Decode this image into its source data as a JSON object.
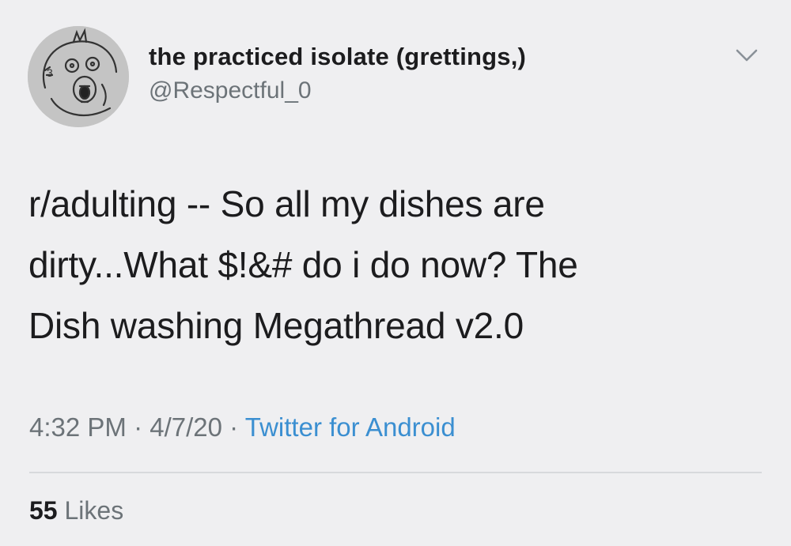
{
  "author": {
    "display_name": "the practiced isolate (grettings,)",
    "handle": "@Respectful_0",
    "avatar_icon": "hand-drawn-face-avatar"
  },
  "tweet": {
    "text": "r/adulting -- So all my dishes are\ndirty...What $!&# do i do now? The\nDish washing Megathread v2.0"
  },
  "meta": {
    "time": "4:32 PM",
    "separator": "·",
    "date": "4/7/20",
    "source": "Twitter for Android"
  },
  "stats": {
    "likes_count": "55",
    "likes_label": "Likes"
  },
  "colors": {
    "background": "#efeff1",
    "text": "#1c1c1e",
    "secondary_text": "#6c7378",
    "link": "#3b8fd1"
  },
  "icons": {
    "menu": "chevron-down-icon"
  }
}
